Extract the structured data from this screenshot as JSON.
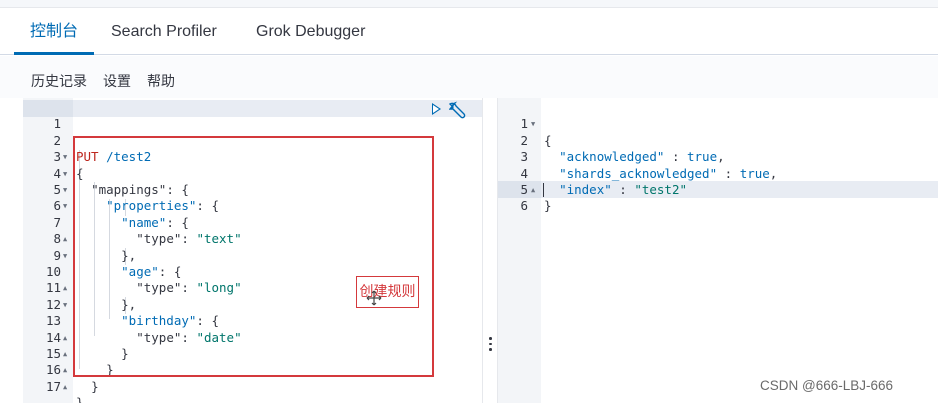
{
  "tabs": [
    {
      "label": "控制台",
      "active": true
    },
    {
      "label": "Search Profiler",
      "active": false
    },
    {
      "label": "Grok Debugger",
      "active": false
    }
  ],
  "menu": {
    "history": "历史记录",
    "settings": "设置",
    "help": "帮助"
  },
  "request": {
    "method": "PUT",
    "path": "/test2",
    "line_numbers": [
      "1",
      "2",
      "3",
      "4",
      "5",
      "6",
      "7",
      "8",
      "9",
      "10",
      "11",
      "12",
      "13",
      "14",
      "15",
      "16",
      "17"
    ],
    "lines": {
      "l3": "{",
      "l4_key": "\"mappings\"",
      "l4_rest": ": {",
      "l5_key": "\"properties\"",
      "l5_rest": ": {",
      "l6_key": "\"name\"",
      "l6_rest": ": {",
      "l7_key": "\"type\"",
      "l7_colon": ": ",
      "l7_val": "\"text\"",
      "l8": "},",
      "l9_key": "\"age\"",
      "l9_rest": ": {",
      "l10_key": "\"type\"",
      "l10_colon": ": ",
      "l10_val": "\"long\"",
      "l11": "},",
      "l12_key": "\"birthday\"",
      "l12_rest": ": {",
      "l13_key": "\"type\"",
      "l13_colon": ": ",
      "l13_val": "\"date\"",
      "l14": "}",
      "l15": "}",
      "l16": "}",
      "l17": "}"
    }
  },
  "annotation": "创建规则",
  "response": {
    "line_numbers": [
      "1",
      "2",
      "3",
      "4",
      "5",
      "6"
    ],
    "l1": "{",
    "l2_key": "\"acknowledged\"",
    "l2_colon": " : ",
    "l2_val": "true",
    "l2_end": ",",
    "l3_key": "\"shards_acknowledged\"",
    "l3_colon": " : ",
    "l3_val": "true",
    "l3_end": ",",
    "l4_key": "\"index\"",
    "l4_colon": " : ",
    "l4_val": "\"test2\"",
    "l5": "}"
  },
  "watermark": "CSDN @666-LBJ-666",
  "colors": {
    "accent": "#006bb4",
    "annotation": "#d4393c",
    "string": "#00756b"
  },
  "icons": [
    "play-icon",
    "wrench-icon",
    "resize-icon",
    "cursor-icon"
  ]
}
